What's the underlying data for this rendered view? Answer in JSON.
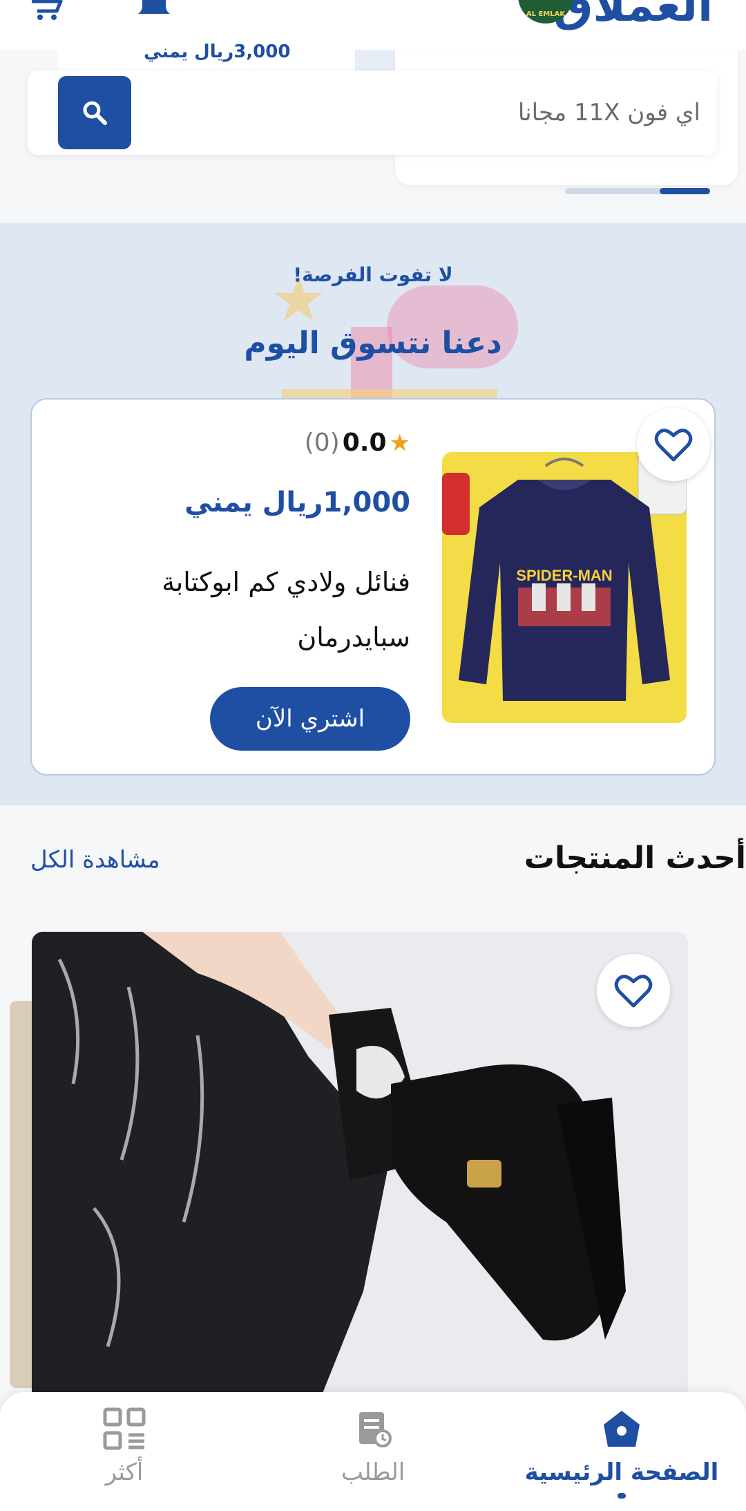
{
  "header": {
    "brand": "العملاق",
    "logo_text": "AL EMLAK",
    "cart_icon": "cart-icon",
    "bell_icon": "bell-icon"
  },
  "hero": {
    "peek_price": "3,000ريال يمني",
    "search": {
      "placeholder": "اي فون 11X مجانا",
      "value": ""
    },
    "carousel_progress": 0.35
  },
  "promo": {
    "tag": "لا تفوت الفرصة!",
    "title": "دعنا نتسوق اليوم",
    "deal": {
      "rating": "0.0",
      "reviews": "(0)",
      "price": "1,000ريال يمني",
      "name": "فنائل ولادي كم ابوكتابة سبايدرمان",
      "buy_label": "اشتري الآن",
      "image_text": "SPIDER-MAN",
      "favorite_icon": "heart-outline-icon"
    }
  },
  "latest": {
    "title": "أحدث المنتجات",
    "view_all": "مشاهدة الكل",
    "favorite_icon": "heart-outline-icon"
  },
  "nav": {
    "items": [
      {
        "label": "الصفحة الرئيسية",
        "icon": "home-icon",
        "active": true
      },
      {
        "label": "الطلب",
        "icon": "orders-icon",
        "active": false
      },
      {
        "label": "أكثر",
        "icon": "more-grid-icon",
        "active": false
      }
    ]
  },
  "colors": {
    "primary": "#1e4fa3",
    "star": "#f0a019",
    "promo_bg": "#dfe7f3"
  }
}
